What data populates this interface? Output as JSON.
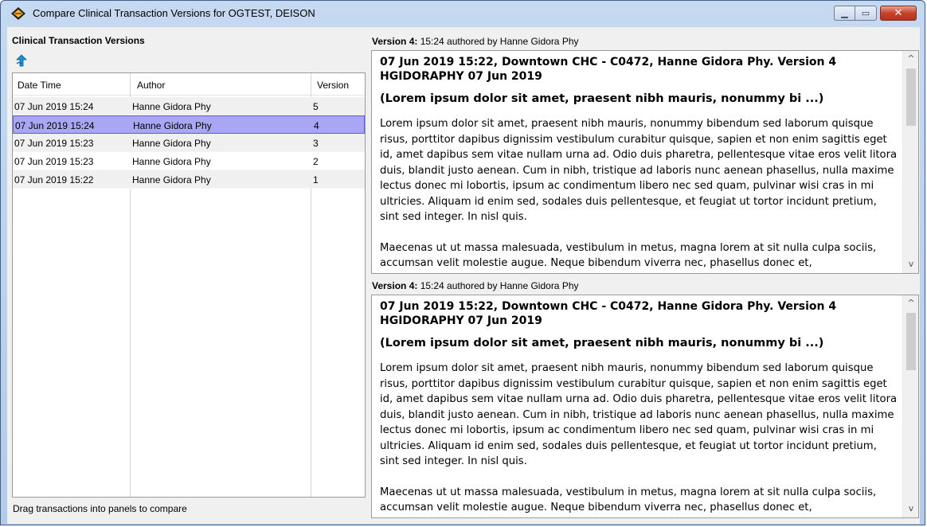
{
  "window": {
    "title": "Compare Clinical Transaction Versions for OGTEST, DEISON",
    "minimize_glyph": "▁",
    "maximize_glyph": "▭",
    "close_glyph": "✕"
  },
  "left": {
    "heading": "Clinical Transaction Versions",
    "columns": [
      "Date Time",
      "Author",
      "Version"
    ],
    "rows": [
      {
        "date": "07 Jun 2019 15:24",
        "author": "Hanne Gidora Phy",
        "version": "5",
        "selected": false
      },
      {
        "date": "07 Jun 2019 15:24",
        "author": "Hanne Gidora Phy",
        "version": "4",
        "selected": true
      },
      {
        "date": "07 Jun 2019 15:23",
        "author": "Hanne Gidora Phy",
        "version": "3",
        "selected": false
      },
      {
        "date": "07 Jun 2019 15:23",
        "author": "Hanne Gidora Phy",
        "version": "2",
        "selected": false
      },
      {
        "date": "07 Jun 2019 15:22",
        "author": "Hanne Gidora Phy",
        "version": "1",
        "selected": false
      }
    ],
    "status": "Drag transactions into panels to compare"
  },
  "panels": [
    {
      "label_bold": "Version 4:",
      "label_rest": " 15:24 authored by Hanne Gidora Phy",
      "title": "07 Jun 2019 15:22, Downtown CHC - C0472, Hanne Gidora Phy.  Version 4 HGIDORAPHY 07 Jun 2019",
      "subtitle": "(Lorem ipsum dolor sit amet, praesent nibh mauris, nonummy bi ...)",
      "para1": "Lorem ipsum dolor sit amet, praesent nibh mauris, nonummy bibendum sed laborum quisque risus, porttitor dapibus dignissim vestibulum curabitur quisque, sapien et non enim sagittis eget id, amet dapibus sem vitae nullam urna ad. Odio duis pharetra, pellentesque vitae eros velit litora duis, blandit justo aenean. Cum in nibh, tristique ad laboris nunc aenean phasellus, nulla maxime lectus donec mi lobortis, ipsum ac condimentum libero nec sed quam, pulvinar wisi cras in mi ultricies. Aliquam id enim sed, sodales duis pellentesque, et feugiat ut tortor incidunt pretium, sint sed integer. In nisl quis.",
      "para2": "Maecenas ut ut massa malesuada, vestibulum in metus, magna lorem at sit nulla culpa sociis, accumsan velit molestie augue. Neque bibendum viverra nec, phasellus donec et,"
    },
    {
      "label_bold": "Version 4:",
      "label_rest": " 15:24 authored by Hanne Gidora Phy",
      "title": "07 Jun 2019 15:22, Downtown CHC - C0472, Hanne Gidora Phy.  Version 4 HGIDORAPHY 07 Jun 2019",
      "subtitle": "(Lorem ipsum dolor sit amet, praesent nibh mauris, nonummy bi ...)",
      "para1": "Lorem ipsum dolor sit amet, praesent nibh mauris, nonummy bibendum sed laborum quisque risus, porttitor dapibus dignissim vestibulum curabitur quisque, sapien et non enim sagittis eget id, amet dapibus sem vitae nullam urna ad. Odio duis pharetra, pellentesque vitae eros velit litora duis, blandit justo aenean. Cum in nibh, tristique ad laboris nunc aenean phasellus, nulla maxime lectus donec mi lobortis, ipsum ac condimentum libero nec sed quam, pulvinar wisi cras in mi ultricies. Aliquam id enim sed, sodales duis pellentesque, et feugiat ut tortor incidunt pretium, sint sed integer. In nisl quis.",
      "para2": "Maecenas ut ut massa malesuada, vestibulum in metus, magna lorem at sit nulla culpa sociis, accumsan velit molestie augue. Neque bibendum viverra nec, phasellus donec et,"
    }
  ],
  "scroll": {
    "up_glyph": "^",
    "down_glyph": "v"
  },
  "icons": {
    "app": "compare-app-icon",
    "refresh": "blue-up-arrow-icon"
  },
  "colors": {
    "selected_row": "#a9a7f3",
    "selected_border": "#5d5be0",
    "close_button": "#c8412a"
  }
}
